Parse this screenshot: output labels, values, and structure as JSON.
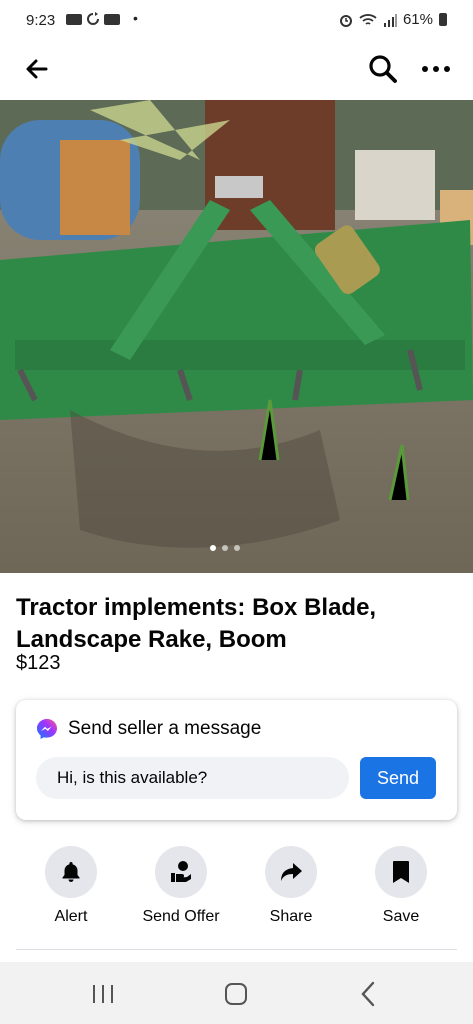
{
  "status_bar": {
    "time": "9:23",
    "dot": "•",
    "battery_percent": "61%",
    "icons": [
      "youtube-icon",
      "sync-icon",
      "youtube-icon",
      "alarm-icon",
      "wifi-icon",
      "signal-icon",
      "battery-icon"
    ]
  },
  "top_bar": {
    "icons": [
      "back-arrow-icon",
      "search-icon",
      "more-icon"
    ]
  },
  "listing": {
    "photo_count": 3,
    "photo_active_index": 0,
    "title": "Tractor implements: Box Blade, Landscape Rake, Boom",
    "price": "$123"
  },
  "message": {
    "icon": "messenger-icon",
    "heading": "Send seller a message",
    "input_value": "Hi, is this available?",
    "send_label": "Send",
    "accent_color": "#1b74e4"
  },
  "actions": [
    {
      "label": "Alert",
      "icon": "bell-icon"
    },
    {
      "label": "Send Offer",
      "icon": "offer-icon"
    },
    {
      "label": "Share",
      "icon": "share-icon"
    },
    {
      "label": "Save",
      "icon": "bookmark-icon"
    }
  ],
  "nav_bar": {
    "icons": [
      "recent-apps-icon",
      "home-icon",
      "back-icon"
    ]
  }
}
